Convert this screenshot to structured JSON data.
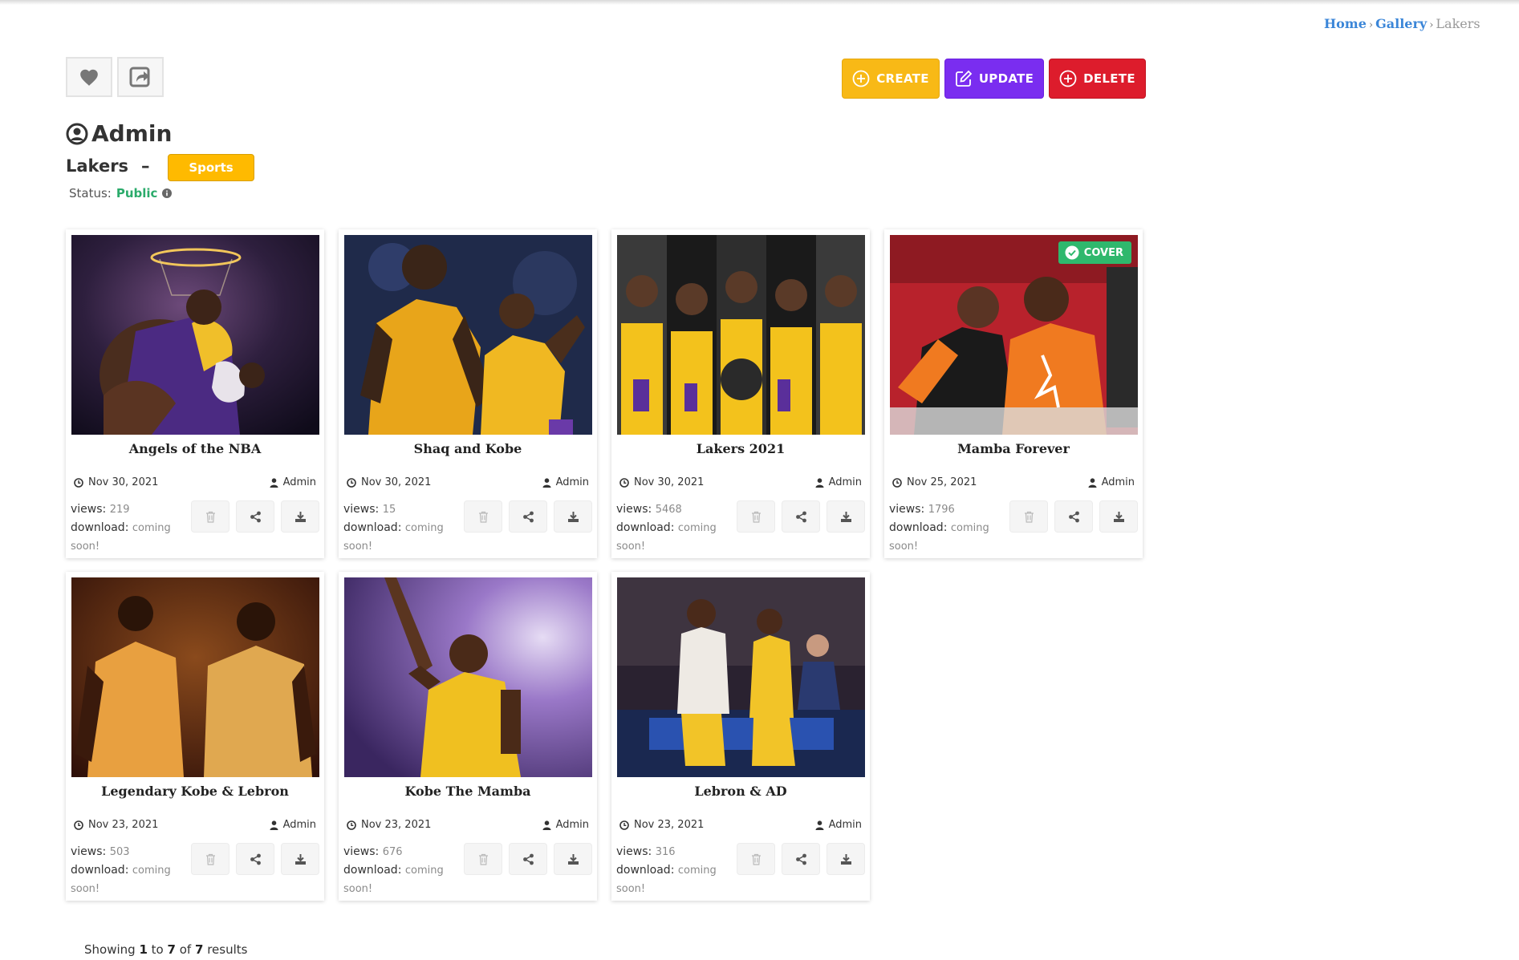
{
  "breadcrumb": {
    "home": "Home",
    "gallery": "Gallery",
    "current": "Lakers"
  },
  "actions": {
    "create": "CREATE",
    "update": "UPDATE",
    "delete": "DELETE"
  },
  "owner": "Admin",
  "album": {
    "name": "Lakers",
    "separator": "–",
    "category": "Sports"
  },
  "status": {
    "label": "Status:",
    "value": "Public"
  },
  "cover_label": "COVER",
  "labels": {
    "views": "views:",
    "download": "download:",
    "download_value": "coming soon!"
  },
  "photos": [
    {
      "title": "Angels of the NBA",
      "date": "Nov 30, 2021",
      "author": "Admin",
      "views": "219"
    },
    {
      "title": "Shaq and Kobe",
      "date": "Nov 30, 2021",
      "author": "Admin",
      "views": "15"
    },
    {
      "title": "Lakers 2021",
      "date": "Nov 30, 2021",
      "author": "Admin",
      "views": "5468"
    },
    {
      "title": "Mamba Forever",
      "date": "Nov 25, 2021",
      "author": "Admin",
      "views": "1796"
    },
    {
      "title": "Legendary Kobe & Lebron",
      "date": "Nov 23, 2021",
      "author": "Admin",
      "views": "503"
    },
    {
      "title": "Kobe The Mamba",
      "date": "Nov 23, 2021",
      "author": "Admin",
      "views": "676"
    },
    {
      "title": "Lebron & AD",
      "date": "Nov 23, 2021",
      "author": "Admin",
      "views": "316"
    }
  ],
  "pagination": {
    "prefix": "Showing",
    "from": "1",
    "to_word": "to",
    "to": "7",
    "of_word": "of",
    "total": "7",
    "suffix": "results"
  },
  "colors": {
    "create": "#f8b916",
    "update": "#7a2df0",
    "delete": "#dd1c2c",
    "tag": "#ffba00",
    "public": "#2bab6b",
    "link": "#3b86d8"
  }
}
